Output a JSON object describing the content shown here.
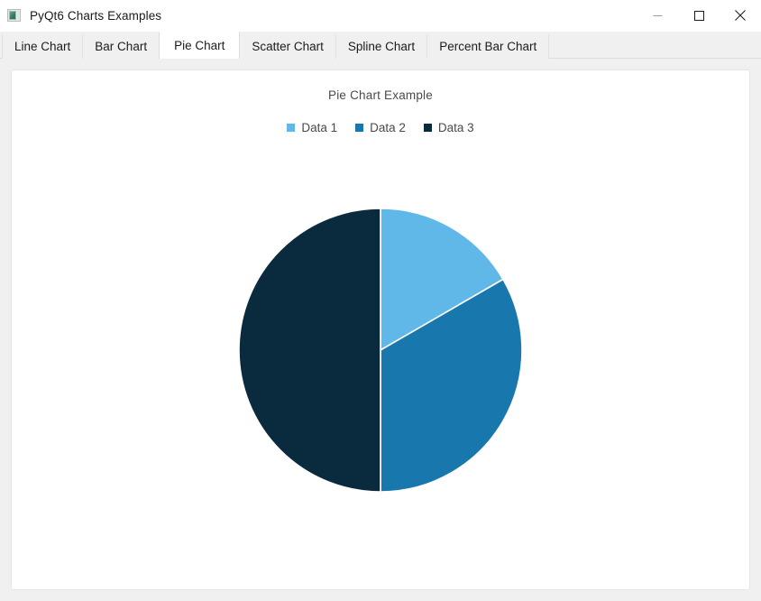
{
  "window": {
    "title": "PyQt6 Charts Examples",
    "icon": "app-icon",
    "controls": {
      "minimize": "minimize-icon",
      "maximize": "maximize-icon",
      "close": "close-icon"
    }
  },
  "tabs": [
    {
      "label": "Line Chart",
      "active": false
    },
    {
      "label": "Bar Chart",
      "active": false
    },
    {
      "label": "Pie Chart",
      "active": true
    },
    {
      "label": "Scatter Chart",
      "active": false
    },
    {
      "label": "Spline Chart",
      "active": false
    },
    {
      "label": "Percent Bar Chart",
      "active": false
    }
  ],
  "chart_data": {
    "type": "pie",
    "title": "Pie Chart Example",
    "xlabel": "",
    "ylabel": "",
    "legend_position": "top",
    "grid": false,
    "labels": [
      "Data 1",
      "Data 2",
      "Data 3"
    ],
    "values": [
      1,
      2,
      3
    ],
    "percentages": [
      16.67,
      33.33,
      50.0
    ],
    "start_angle_deg": 0,
    "slice_angles_deg": [
      60,
      120,
      180
    ],
    "colors": [
      "#5fb8e8",
      "#1878ad",
      "#0a2a3e"
    ],
    "slice_border_color": "#ffffff",
    "center": {
      "x": 165,
      "y": 160
    },
    "radius": 157,
    "series": [
      {
        "name": "Data 1",
        "value": 1,
        "percent": 16.67,
        "color": "#5fb8e8"
      },
      {
        "name": "Data 2",
        "value": 2,
        "percent": 33.33,
        "color": "#1878ad"
      },
      {
        "name": "Data 3",
        "value": 3,
        "percent": 50.0,
        "color": "#0a2a3e"
      }
    ]
  },
  "theme": {
    "window_background": "#f0f0f0",
    "panel_background": "#ffffff",
    "panel_border": "#e6e6e6",
    "title_text": "#1b1b1b",
    "chart_text": "#4a4a4a",
    "tab_inactive_background": "#f0f0f0",
    "tab_active_background": "#ffffff"
  }
}
